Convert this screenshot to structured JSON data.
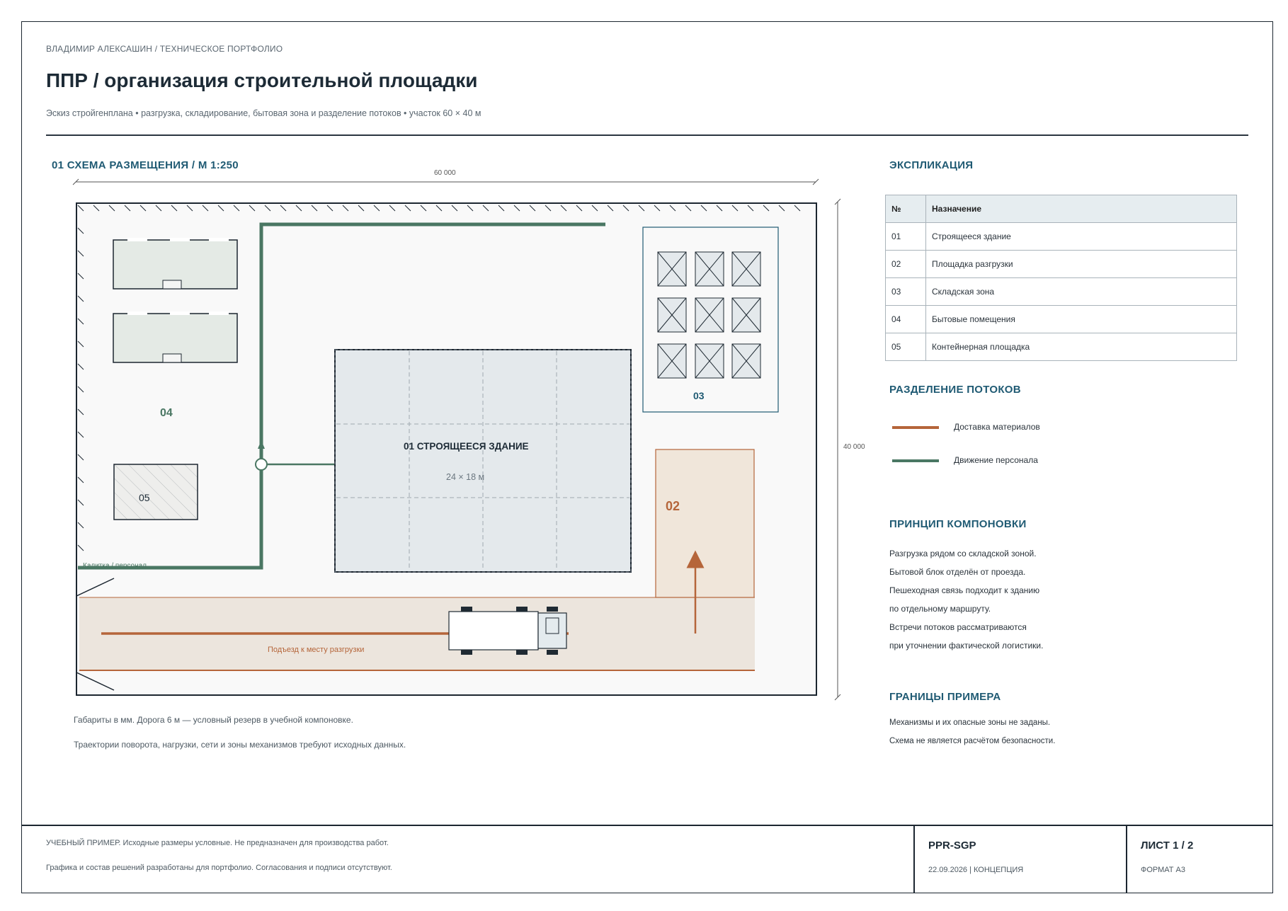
{
  "header": {
    "author": "ВЛАДИМИР АЛЕКСАШИН  /  ТЕХНИЧЕСКОЕ ПОРТФОЛИО",
    "title": "ППР / организация строительной площадки",
    "subtitle": "Эскиз стройгенплана • разгрузка, складирование, бытовая зона и разделение потоков • участок 60 × 40 м"
  },
  "plan": {
    "section_title": "01  СХЕМА РАЗМЕЩЕНИЯ  /  М 1:250",
    "dim_width": "60 000",
    "dim_height": "40 000",
    "building_label": "01  СТРОЯЩЕЕСЯ ЗДАНИЕ",
    "building_size": "24 × 18 м",
    "zone_03": "03",
    "zone_04": "04",
    "zone_05": "05",
    "zone_02": "02",
    "gate_label": "Калитка / персонал",
    "road_label": "Подъезд к месту разгрузки",
    "note_1": "Габариты в мм. Дорога 6 м — условный резерв в учебной компоновке.",
    "note_2": "Траектории поворота, нагрузки, сети и зоны механизмов требуют исходных данных."
  },
  "explication": {
    "title": "ЭКСПЛИКАЦИЯ",
    "col_num": "№",
    "col_name": "Назначение",
    "rows": [
      {
        "num": "01",
        "name": "Строящееся здание"
      },
      {
        "num": "02",
        "name": "Площадка разгрузки"
      },
      {
        "num": "03",
        "name": "Складская зона"
      },
      {
        "num": "04",
        "name": "Бытовые помещения"
      },
      {
        "num": "05",
        "name": "Контейнерная площадка"
      }
    ]
  },
  "flows": {
    "title": "РАЗДЕЛЕНИЕ ПОТОКОВ",
    "materials": "Доставка материалов",
    "personnel": "Движение персонала",
    "materials_color": "#b5653a",
    "personnel_color": "#4a7763"
  },
  "principle": {
    "title": "ПРИНЦИП КОМПОНОВКИ",
    "lines": [
      "Разгрузка рядом со складской зоной.",
      "Бытовой блок отделён от проезда.",
      "Пешеходная связь подходит к зданию",
      "по отдельному маршруту.",
      "Встречи потоков рассматриваются",
      "при уточнении фактической логистики."
    ]
  },
  "limits": {
    "title": "ГРАНИЦЫ ПРИМЕРА",
    "lines": [
      "Механизмы и их опасные зоны не заданы.",
      "Схема не является расчётом безопасности."
    ]
  },
  "footer": {
    "note_1": "УЧЕБНЫЙ ПРИМЕР. Исходные размеры условные. Не предназначен для производства работ.",
    "note_2": "Графика и состав решений разработаны для портфолио. Согласования и подписи отсутствуют.",
    "code": "PPR-SGP",
    "date_stage": "22.09.2026  |  КОНЦЕПЦИЯ",
    "sheet": "ЛИСТ 1 / 2",
    "format": "ФОРМАТ А3"
  }
}
